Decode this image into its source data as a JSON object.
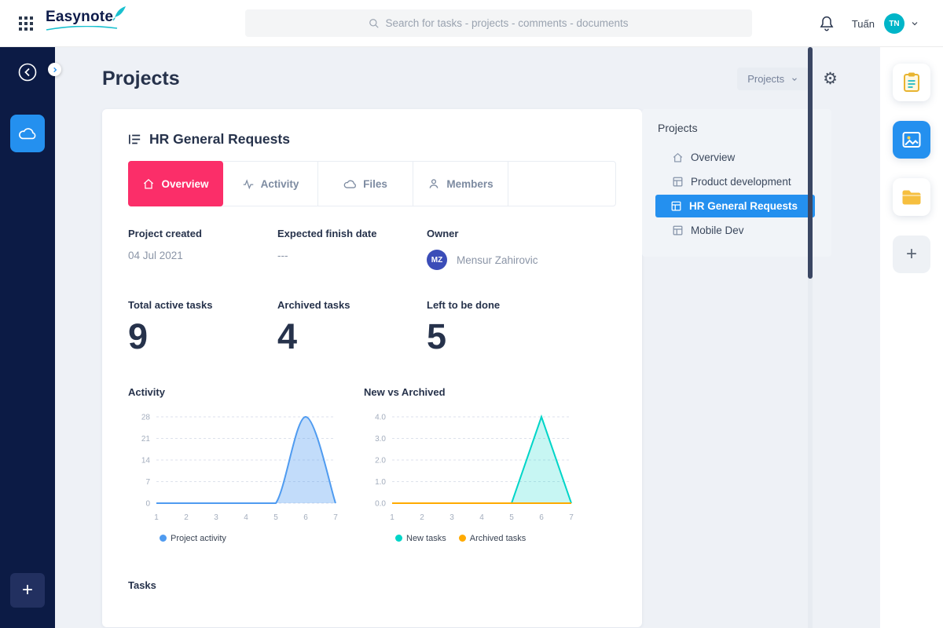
{
  "colors": {
    "navy": "#0c1b45",
    "accent_blue": "#2490ef",
    "accent_pink": "#fb2e69",
    "teal": "#19c0cf",
    "chart_blue": "#4f9bf0",
    "chart_teal": "#00d5c8",
    "chart_orange": "#ffaa00"
  },
  "topbar": {
    "logo": "Easynote",
    "search_placeholder": "Search for tasks - projects - comments - documents",
    "user_name": "Tuấn",
    "avatar_initials": "TN"
  },
  "page": {
    "title": "Projects",
    "view_dropdown": "Projects"
  },
  "project_card": {
    "title": "HR General Requests",
    "tabs": [
      {
        "label": "Overview",
        "active": true
      },
      {
        "label": "Activity",
        "active": false
      },
      {
        "label": "Files",
        "active": false
      },
      {
        "label": "Members",
        "active": false
      }
    ],
    "info": [
      {
        "label": "Project created",
        "value": "04 Jul 2021"
      },
      {
        "label": "Expected finish date",
        "value": "---"
      },
      {
        "label": "Owner",
        "value": "Mensur Zahirovic",
        "avatar_initials": "MZ"
      }
    ],
    "stats": [
      {
        "label": "Total active tasks",
        "value": "9"
      },
      {
        "label": "Archived tasks",
        "value": "4"
      },
      {
        "label": "Left to be done",
        "value": "5"
      }
    ],
    "tasks_heading": "Tasks"
  },
  "projects_panel": {
    "title": "Projects",
    "items": [
      {
        "label": "Overview",
        "icon": "home-icon",
        "active": false
      },
      {
        "label": "Product development",
        "icon": "grid-icon",
        "active": false
      },
      {
        "label": "HR General Requests",
        "icon": "grid-icon",
        "active": true
      },
      {
        "label": "Mobile Dev",
        "icon": "grid-icon",
        "active": false
      }
    ]
  },
  "chart_data": [
    {
      "type": "area",
      "title": "Activity",
      "x": [
        1,
        2,
        3,
        4,
        5,
        6,
        7
      ],
      "series": [
        {
          "name": "Project activity",
          "values": [
            0,
            0,
            0,
            0,
            0,
            28,
            0
          ],
          "color": "#4f9bf0",
          "fill": "rgba(79,155,240,0.35)",
          "smooth": true
        }
      ],
      "ylim": [
        0,
        28
      ],
      "yticks": [
        0,
        7,
        14,
        21,
        28
      ],
      "ytick_labels": [
        "0",
        "7",
        "14",
        "21",
        "28"
      ],
      "grid": true,
      "legend_position": "bottom"
    },
    {
      "type": "area",
      "title": "New vs Archived",
      "x": [
        1,
        2,
        3,
        4,
        5,
        6,
        7
      ],
      "series": [
        {
          "name": "New tasks",
          "values": [
            0,
            0,
            0,
            0,
            0,
            4,
            0
          ],
          "color": "#00d5c8",
          "fill": "rgba(0,213,200,0.22)",
          "smooth": false
        },
        {
          "name": "Archived tasks",
          "values": [
            0,
            0,
            0,
            0,
            0,
            0,
            0
          ],
          "color": "#ffaa00",
          "fill": "none",
          "smooth": false
        }
      ],
      "ylim": [
        0,
        4
      ],
      "yticks": [
        0,
        1,
        2,
        3,
        4
      ],
      "ytick_labels": [
        "0.0",
        "1.0",
        "2.0",
        "3.0",
        "4.0"
      ],
      "grid": true,
      "legend_position": "bottom"
    }
  ],
  "right_rail": {
    "items": [
      "notes",
      "projects",
      "files",
      "add"
    ]
  }
}
